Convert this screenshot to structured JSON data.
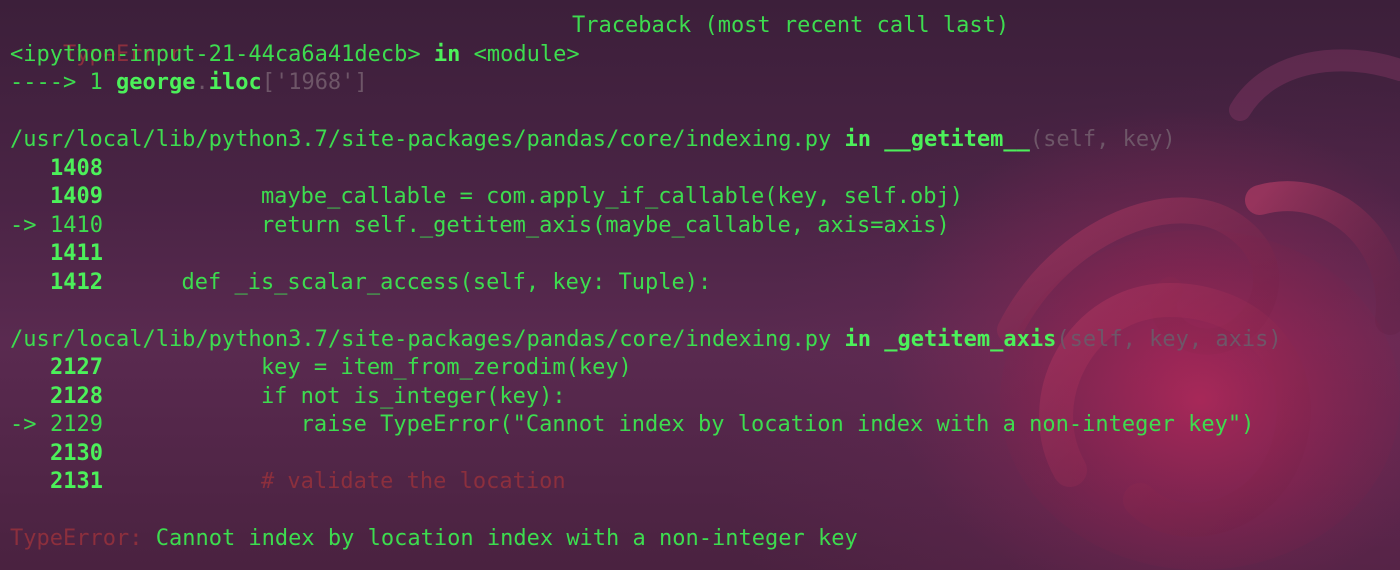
{
  "traceback": {
    "error_name": "TypeError",
    "header_title": "Traceback (most recent call last)",
    "input_ref": "<ipython-input-21-44ca6a41decb>",
    "in_word": "in",
    "module": "<module>",
    "arrow_line": {
      "arrow": "---->",
      "number": "1",
      "code_obj": "george",
      "code_dot": ".",
      "code_attr": "iloc",
      "code_open": "[",
      "code_arg": "'1968'",
      "code_close": "]"
    },
    "frames": [
      {
        "path": "/usr/local/lib/python3.7/site-packages/pandas/core/indexing.py",
        "in_word": "in",
        "func": "__getitem__",
        "sig": "(self, key)",
        "lines": [
          {
            "marker": "",
            "num": "1408",
            "code": ""
          },
          {
            "marker": "",
            "num": "1409",
            "code": "            maybe_callable = com.apply_if_callable(key, self.obj)"
          },
          {
            "marker": "->",
            "num": "1410",
            "code": "            return self._getitem_axis(maybe_callable, axis=axis)"
          },
          {
            "marker": "",
            "num": "1411",
            "code": ""
          },
          {
            "marker": "",
            "num": "1412",
            "code": "      def _is_scalar_access(self, key: Tuple):"
          }
        ]
      },
      {
        "path": "/usr/local/lib/python3.7/site-packages/pandas/core/indexing.py",
        "in_word": "in",
        "func": "_getitem_axis",
        "sig": "(self, key, axis)",
        "lines": [
          {
            "marker": "",
            "num": "2127",
            "code": "            key = item_from_zerodim(key)"
          },
          {
            "marker": "",
            "num": "2128",
            "code": "            if not is_integer(key):"
          },
          {
            "marker": "->",
            "num": "2129",
            "code": "               raise TypeError(\"Cannot index by location index with a non-integer key\")"
          },
          {
            "marker": "",
            "num": "2130",
            "code": ""
          },
          {
            "marker": "",
            "num": "2131",
            "code": "            # validate the location"
          }
        ]
      }
    ],
    "final_error": {
      "name": "TypeError",
      "sep": ":",
      "message": " Cannot index by location index with a non-integer key"
    }
  },
  "colors": {
    "text_green": "#3ddc4f",
    "error_red": "#8c2f3d",
    "comment_muted": "#6e5668",
    "background": "#4a2445"
  }
}
